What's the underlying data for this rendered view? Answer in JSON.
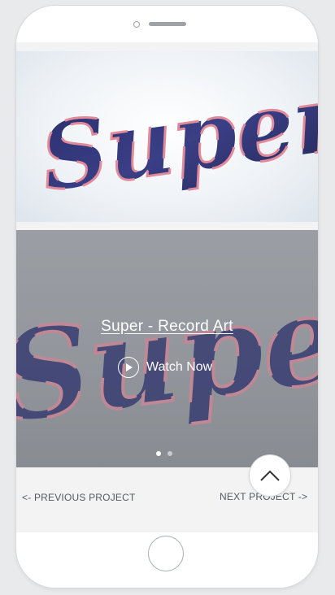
{
  "hero": {
    "script_word": "Super"
  },
  "slide": {
    "script_word": "Super",
    "title": "Super - Record Art",
    "watch_label": "Watch Now",
    "dots": [
      true,
      false
    ]
  },
  "nav": {
    "prev_label": "<- PREVIOUS PROJECT",
    "next_label": "NEXT PROJECT ->"
  },
  "colors": {
    "lettering_blue": "#2b2f6e",
    "lettering_pink": "#e08a9a",
    "slide_gray": "#9ca0a5"
  },
  "icons": {
    "back_to_top": "chevron-up-icon",
    "play": "play-icon"
  }
}
